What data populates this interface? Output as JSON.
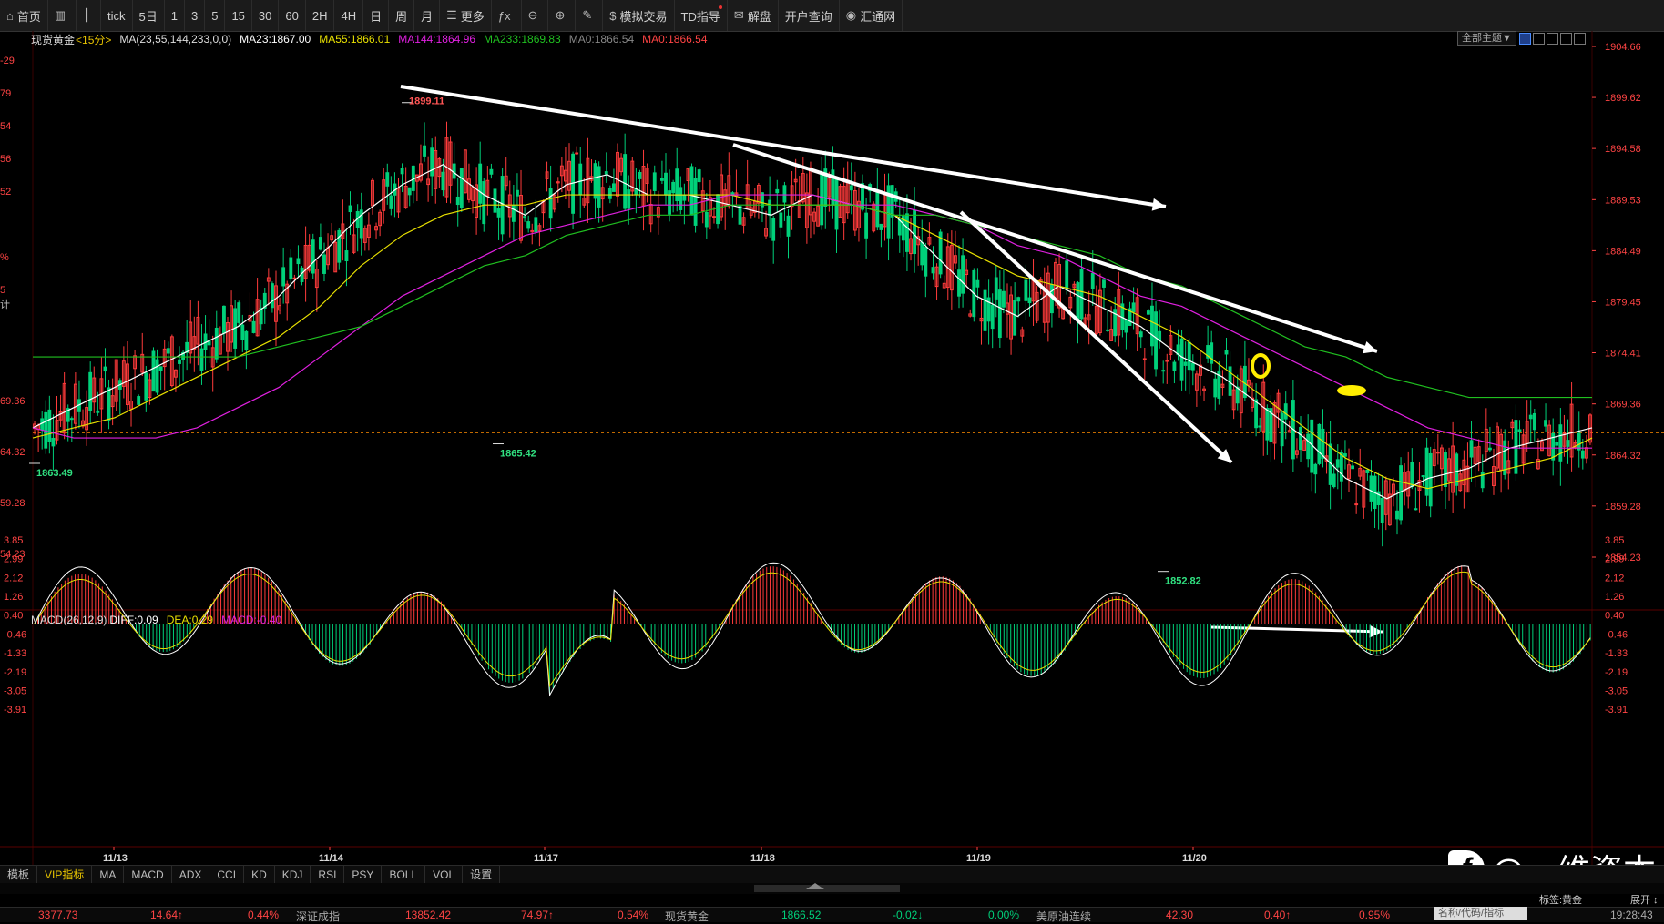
{
  "toolbar": {
    "items": [
      {
        "label": "首页",
        "icon": "home-icon"
      },
      {
        "label": "",
        "icon": "bars-icon"
      },
      {
        "label": "",
        "icon": "candle-icon"
      },
      {
        "label": "tick",
        "icon": ""
      },
      {
        "label": "5日",
        "icon": ""
      },
      {
        "label": "1",
        "icon": ""
      },
      {
        "label": "3",
        "icon": ""
      },
      {
        "label": "5",
        "icon": ""
      },
      {
        "label": "15",
        "icon": ""
      },
      {
        "label": "30",
        "icon": ""
      },
      {
        "label": "60",
        "icon": ""
      },
      {
        "label": "2H",
        "icon": ""
      },
      {
        "label": "4H",
        "icon": ""
      },
      {
        "label": "日",
        "icon": ""
      },
      {
        "label": "周",
        "icon": ""
      },
      {
        "label": "月",
        "icon": ""
      },
      {
        "label": "更多",
        "icon": "list-icon"
      },
      {
        "label": "",
        "icon": "fx-icon"
      },
      {
        "label": "",
        "icon": "zoom-out-icon"
      },
      {
        "label": "",
        "icon": "zoom-in-icon"
      },
      {
        "label": "",
        "icon": "pen-icon"
      },
      {
        "label": "模拟交易",
        "icon": "dollar-icon"
      },
      {
        "label": "TD指导",
        "icon": ""
      },
      {
        "label": "解盘",
        "icon": "chat-icon"
      },
      {
        "label": "开户查询",
        "icon": ""
      },
      {
        "label": "汇通网",
        "icon": "logo-icon"
      }
    ]
  },
  "info": {
    "symbol": "现货黄金",
    "period": "<15分>",
    "ma_params": "MA(23,55,144,233,0,0)",
    "ma23": "MA23:1867.00",
    "ma55": "MA55:1866.01",
    "ma144": "MA144:1864.96",
    "ma233": "MA233:1869.83",
    "ma0a": "MA0:1866.54",
    "ma0b": "MA0:1866.54"
  },
  "theme_button": "全部主题▼",
  "macd_info": {
    "params": "MACD(26,12,9)",
    "diff": "DIFF:0.09",
    "dea": "DEA:0.29",
    "macd": "MACD:-0.40"
  },
  "colors": {
    "up": "#ff3b3b",
    "down": "#00d07a",
    "ma23": "#ffffff",
    "ma55": "#e8e000",
    "ma144": "#e020e0",
    "ma233": "#20c020",
    "axis": "#ff4444"
  },
  "chart_data": {
    "type": "line",
    "price_ticks": [
      "1904.66",
      "1899.62",
      "1894.58",
      "1889.53",
      "1884.49",
      "1879.45",
      "1874.41",
      "1869.36",
      "1864.32",
      "1859.28",
      "1854.23"
    ],
    "left_partial_ticks": [
      "-29",
      "79",
      "54",
      "56",
      "52",
      "%",
      "5",
      "计",
      "69.36",
      "64.32",
      "59.28",
      "54.23"
    ],
    "macd_ticks": [
      "3.85",
      "2.99",
      "2.12",
      "1.26",
      "0.40",
      "-0.46",
      "-1.33",
      "-2.19",
      "-3.05",
      "-3.91"
    ],
    "dates": [
      "11/13",
      "11/14",
      "11/17",
      "11/18",
      "11/19",
      "11/20"
    ],
    "annotations": [
      {
        "label": "1899.11",
        "price": 1899.11
      },
      {
        "label": "1865.42",
        "price": 1865.42
      },
      {
        "label": "1863.49",
        "price": 1863.49
      },
      {
        "label": "1852.82",
        "price": 1852.82
      }
    ],
    "series": [
      {
        "name": "MA23",
        "values": [
          1867,
          1869,
          1871,
          1873,
          1875,
          1877,
          1880,
          1884,
          1888,
          1891,
          1893,
          1890,
          1888,
          1891,
          1892,
          1890,
          1890,
          1889,
          1888,
          1890,
          1889,
          1888,
          1884,
          1880,
          1878,
          1881,
          1879,
          1877,
          1874,
          1872,
          1869,
          1866,
          1862,
          1860,
          1862,
          1863,
          1865,
          1866,
          1867
        ]
      },
      {
        "name": "MA55",
        "values": [
          1866,
          1867,
          1868,
          1870,
          1872,
          1874,
          1876,
          1879,
          1883,
          1886,
          1888,
          1889,
          1889,
          1890,
          1890,
          1890,
          1890,
          1890,
          1889,
          1889,
          1889,
          1888,
          1886,
          1884,
          1882,
          1881,
          1880,
          1878,
          1876,
          1873,
          1870,
          1867,
          1864,
          1862,
          1861,
          1862,
          1863,
          1864,
          1866
        ]
      },
      {
        "name": "MA144",
        "values": [
          1867,
          1866,
          1866,
          1866,
          1867,
          1869,
          1871,
          1874,
          1877,
          1880,
          1882,
          1884,
          1886,
          1887,
          1888,
          1889,
          1889,
          1890,
          1890,
          1890,
          1889,
          1889,
          1888,
          1887,
          1885,
          1884,
          1882,
          1880,
          1879,
          1877,
          1875,
          1873,
          1871,
          1869,
          1867,
          1866,
          1865,
          1865,
          1865
        ]
      },
      {
        "name": "MA233",
        "values": [
          1874,
          1874,
          1874,
          1874,
          1874,
          1874,
          1875,
          1876,
          1877,
          1879,
          1881,
          1883,
          1884,
          1886,
          1887,
          1888,
          1888,
          1889,
          1889,
          1889,
          1889,
          1888,
          1888,
          1887,
          1886,
          1885,
          1884,
          1882,
          1881,
          1879,
          1877,
          1875,
          1874,
          1872,
          1871,
          1870,
          1870,
          1870,
          1870
        ]
      }
    ]
  },
  "bottom_tabs": [
    "模板",
    "VIP指标",
    "MA",
    "MACD",
    "ADX",
    "CCI",
    "KD",
    "KDJ",
    "RSI",
    "PSY",
    "BOLL",
    "VOL",
    "设置"
  ],
  "status": {
    "v1": "3377.73",
    "v2": "14.64↑",
    "v3": "0.44%",
    "name1": "深证成指",
    "v4": "13852.42",
    "v5": "74.97↑",
    "v6": "0.54%",
    "name2": "现货黄金",
    "v7": "1866.52",
    "v8": "-0.02↓",
    "v9": "0.00%",
    "name3": "美原油连续",
    "v10": "42.30",
    "v11": "0.40↑",
    "v12": "0.95%",
    "search_placeholder": "名称/代码/指标",
    "tag": "标签:黄金",
    "expand": "展开 ↕",
    "time": "19:28:43"
  },
  "watermark": "@一维资本"
}
